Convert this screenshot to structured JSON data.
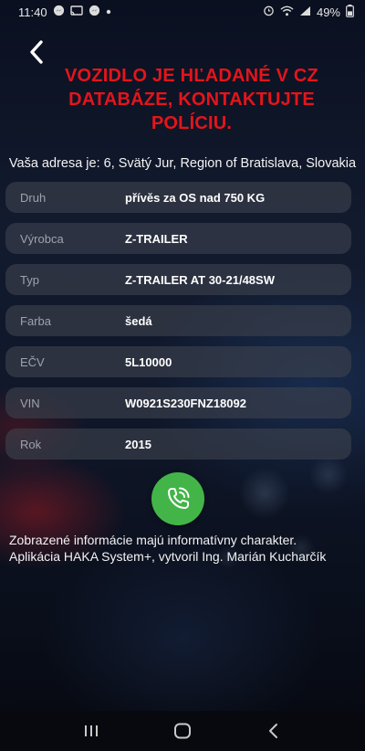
{
  "status_bar": {
    "time": "11:40",
    "left_icons": [
      "messenger-icon",
      "cast-icon",
      "messenger-icon",
      "dot-icon"
    ],
    "battery": "49%"
  },
  "header": {
    "alert": "VOZIDLO JE HĽADANÉ V CZ DATABÁZE, KONTAKTUJTE POLÍCIU.",
    "alert_color": "#e3151b"
  },
  "address": "Vaša adresa je: 6, Svätý Jur, Region of Bratislava, Slovakia",
  "vehicle": {
    "rows": [
      {
        "label": "Druh",
        "value": "přívěs za OS nad 750 KG"
      },
      {
        "label": "Výrobca",
        "value": "Z-TRAILER"
      },
      {
        "label": "Typ",
        "value": "Z-TRAILER AT 30-21/48SW"
      },
      {
        "label": "Farba",
        "value": "šedá"
      },
      {
        "label": "EČV",
        "value": "5L10000"
      },
      {
        "label": "VIN",
        "value": "W0921S230FNZ18092"
      },
      {
        "label": "Rok",
        "value": "2015"
      }
    ]
  },
  "call_button": {
    "icon": "phone-call-icon",
    "color": "#43b548"
  },
  "footer": {
    "line1": "Zobrazené informácie majú informatívny charakter.",
    "line2": "Aplikácia HAKA System+, vytvoril Ing. Marián Kucharčík"
  },
  "nav": {
    "icons": [
      "recent-apps-icon",
      "home-icon",
      "back-icon"
    ]
  }
}
